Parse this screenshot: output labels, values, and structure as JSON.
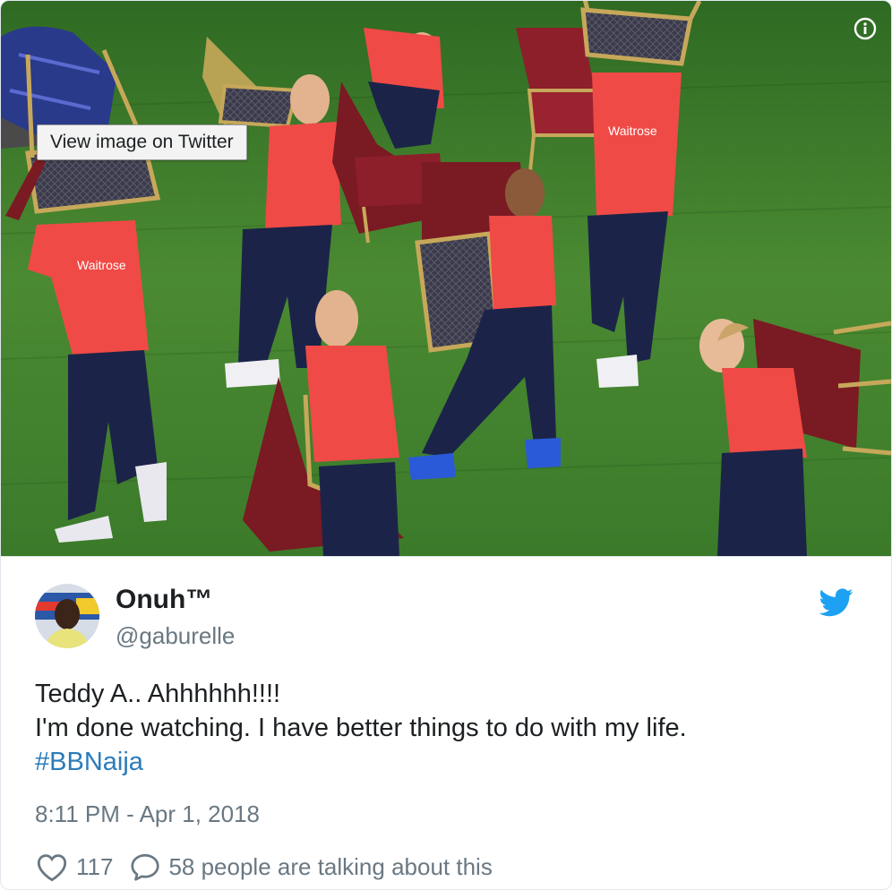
{
  "media": {
    "view_button_label": "View image on Twitter",
    "info_icon": "info-icon",
    "shirt_text": "Waitrose"
  },
  "author": {
    "display_name": "Onuh™",
    "handle": "@gaburelle",
    "avatar": "avatar-photo"
  },
  "tweet": {
    "lines": [
      "Teddy A.. Ahhhhhh!!!!",
      "I'm done watching. I have better things to do with my life."
    ],
    "hashtag": "#BBNaija",
    "timestamp": "8:11 PM - Apr 1, 2018"
  },
  "actions": {
    "like_icon": "heart-icon",
    "like_count": "117",
    "reply_icon": "speech-bubble-icon",
    "talking_text": "58 people are talking about this"
  },
  "colors": {
    "link": "#2b7bb9",
    "twitter_blue": "#1da1f2",
    "secondary_text": "#697882",
    "jersey": "#f04a46",
    "grass": "#3d7a2a"
  }
}
